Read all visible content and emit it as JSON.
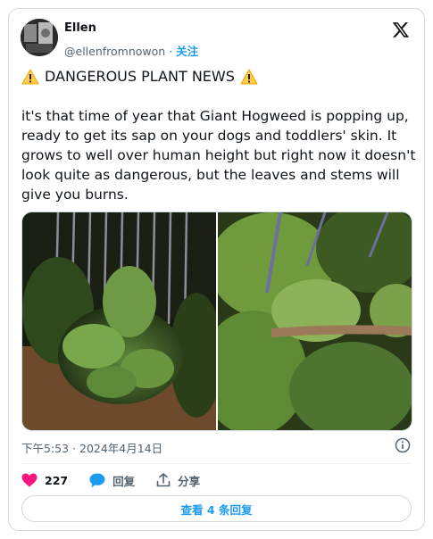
{
  "author": {
    "name": "Ellen",
    "handle": "@ellenfromnowon",
    "separator": "·",
    "follow_label": "关注"
  },
  "tweet": {
    "title": "DANGEROUS PLANT NEWS",
    "body": "it's that time of year that Giant Hogweed is popping up, ready to get its sap on your dogs and toddlers' skin. It grows to well over human height but right now it doesn't look quite as dangerous, but the leaves and stems will give you burns.",
    "timestamp": "下午5:53 · 2024年4月14日"
  },
  "actions": {
    "likes": "227",
    "reply_label": "回复",
    "share_label": "分享"
  },
  "replies_button": "查看 4 条回复",
  "icons": [
    "x-logo-icon",
    "warning-icon",
    "info-icon",
    "heart-icon",
    "reply-bubble-icon",
    "share-icon"
  ],
  "colors": {
    "accent": "#1d9bf0",
    "heart": "#f91880",
    "text": "#0f1419",
    "muted": "#536471"
  }
}
